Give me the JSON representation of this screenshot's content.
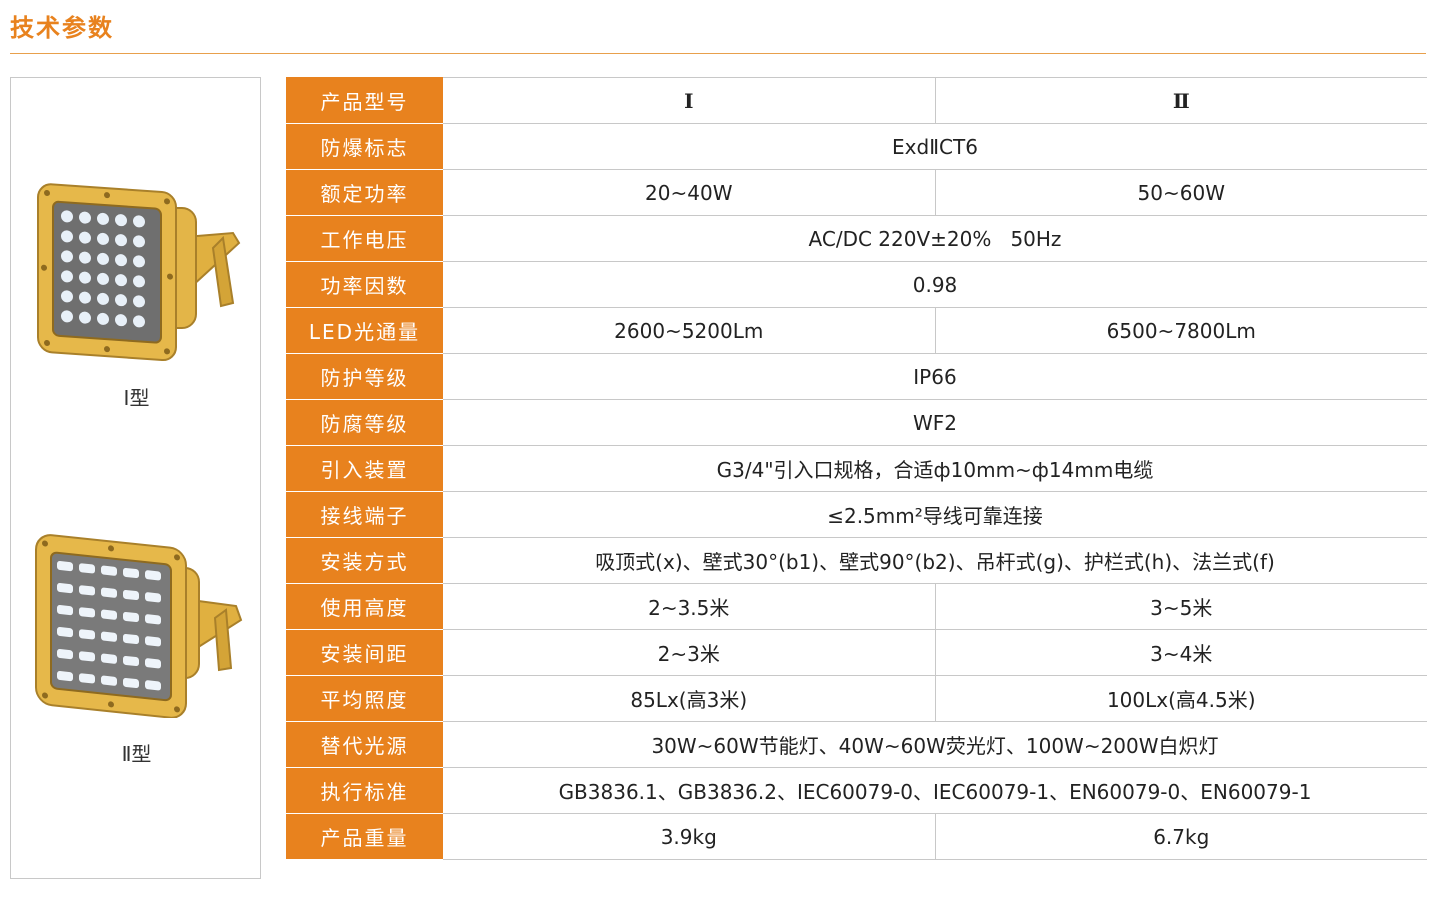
{
  "page": {
    "title": "技术参数"
  },
  "images": [
    {
      "caption": "Ⅰ型"
    },
    {
      "caption": "Ⅱ型"
    }
  ],
  "colors": {
    "accent": "#e8821e",
    "lamp_body": "#e6b84a",
    "border": "#c8c8c8"
  },
  "specs": [
    {
      "label": "产品型号",
      "v1": "Ⅰ",
      "v2": "Ⅱ"
    },
    {
      "label": "防爆标志",
      "value": "ExdⅡCT6"
    },
    {
      "label": "额定功率",
      "v1": "20~40W",
      "v2": "50~60W"
    },
    {
      "label": "工作电压",
      "value": "AC/DC 220V±20%   50Hz"
    },
    {
      "label": "功率因数",
      "value": "0.98"
    },
    {
      "label": "LED光通量",
      "v1": "2600~5200Lm",
      "v2": "6500~7800Lm"
    },
    {
      "label": "防护等级",
      "value": "IP66"
    },
    {
      "label": "防腐等级",
      "value": "WF2"
    },
    {
      "label": "引入装置",
      "value": "G3/4\"引入口规格，合适ф10mm~ф14mm电缆"
    },
    {
      "label": "接线端子",
      "value": "≤2.5mm²导线可靠连接"
    },
    {
      "label": "安装方式",
      "value": "吸顶式(x)、壁式30°(b1)、壁式90°(b2)、吊杆式(g)、护栏式(h)、法兰式(f)"
    },
    {
      "label": "使用高度",
      "v1": "2~3.5米",
      "v2": "3~5米"
    },
    {
      "label": "安装间距",
      "v1": "2~3米",
      "v2": "3~4米"
    },
    {
      "label": "平均照度",
      "v1": "85Lx(高3米)",
      "v2": "100Lx(高4.5米)"
    },
    {
      "label": "替代光源",
      "value": "30W~60W节能灯、40W~60W荧光灯、100W~200W白炽灯"
    },
    {
      "label": "执行标准",
      "value": "GB3836.1、GB3836.2、IEC60079-0、IEC60079-1、EN60079-0、EN60079-1"
    },
    {
      "label": "产品重量",
      "v1": "3.9kg",
      "v2": "6.7kg"
    }
  ]
}
